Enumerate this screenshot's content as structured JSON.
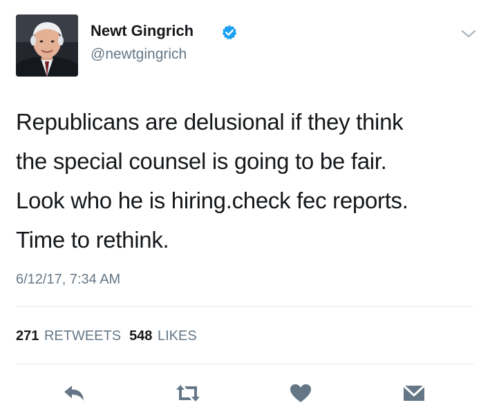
{
  "user": {
    "name": "Newt Gingrich",
    "handle": "@newtgingrich",
    "verified": true
  },
  "tweet": {
    "lines": [
      "Republicans are delusional if they think",
      "the special counsel is going to be fair.",
      "Look who he is hiring.check fec reports.",
      "Time to rethink."
    ],
    "timestamp": "6/12/17, 7:34 AM"
  },
  "stats": {
    "retweets_count": "271",
    "retweets_label": "RETWEETS",
    "likes_count": "548",
    "likes_label": "LIKES"
  },
  "actions": [
    {
      "icon": "reply-icon"
    },
    {
      "icon": "retweet-icon"
    },
    {
      "icon": "like-icon"
    },
    {
      "icon": "message-icon"
    }
  ],
  "colors": {
    "verified_badge": "#1da1f2",
    "secondary_text": "#657786",
    "action_icon": "#657786",
    "divider": "#e1e8ed"
  }
}
